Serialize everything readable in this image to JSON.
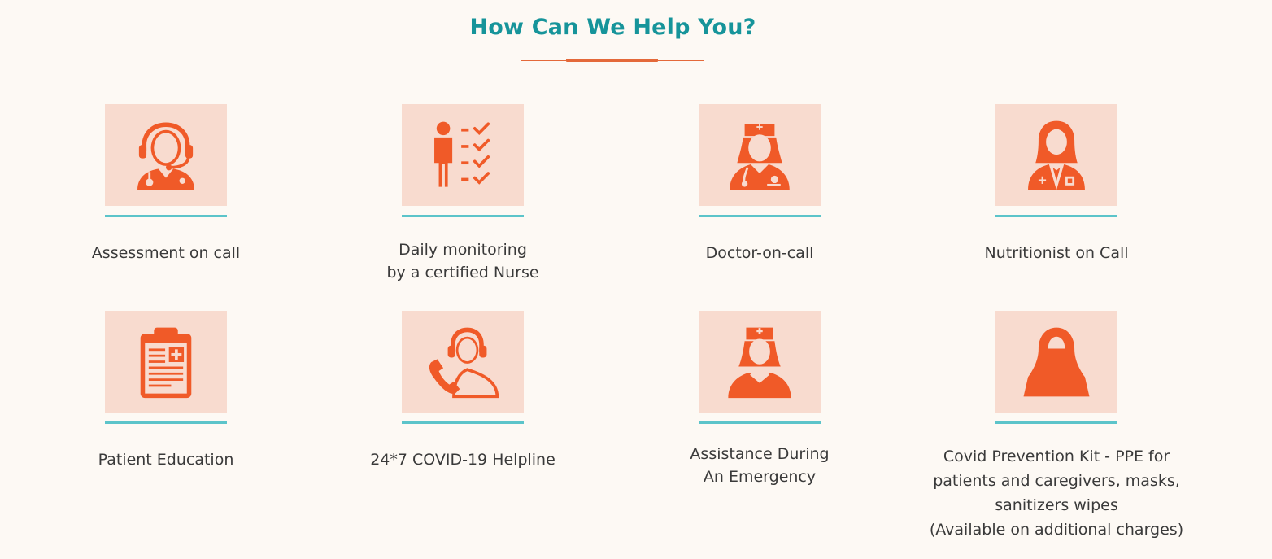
{
  "header": {
    "title": "How Can We Help You?"
  },
  "services": [
    {
      "label": "Assessment on call",
      "icon": "doctor-headset-icon"
    },
    {
      "label": "Daily monitoring\nby a certified Nurse",
      "icon": "monitoring-checklist-icon"
    },
    {
      "label": "Doctor-on-call",
      "icon": "nurse-doctor-icon"
    },
    {
      "label": "Nutritionist on Call",
      "icon": "nutritionist-icon"
    },
    {
      "label": "Patient Education",
      "icon": "clipboard-medical-icon"
    },
    {
      "label": "24*7 COVID-19 Helpline",
      "icon": "helpline-phone-icon"
    },
    {
      "label": "Assistance During\nAn Emergency",
      "icon": "emergency-nurse-icon"
    },
    {
      "label": "Covid Prevention Kit - PPE for\npatients and caregivers, masks,\nsanitizers wipes\n(Available on additional charges)",
      "icon": "ppe-hood-icon"
    }
  ],
  "colors": {
    "title": "#16949a",
    "accent": "#e4693a",
    "icon": "#f05a28",
    "icon_bg": "#f8dbcf",
    "underline": "#5cc4ca",
    "background": "#fdf9f4",
    "text": "#3a3a3a"
  }
}
